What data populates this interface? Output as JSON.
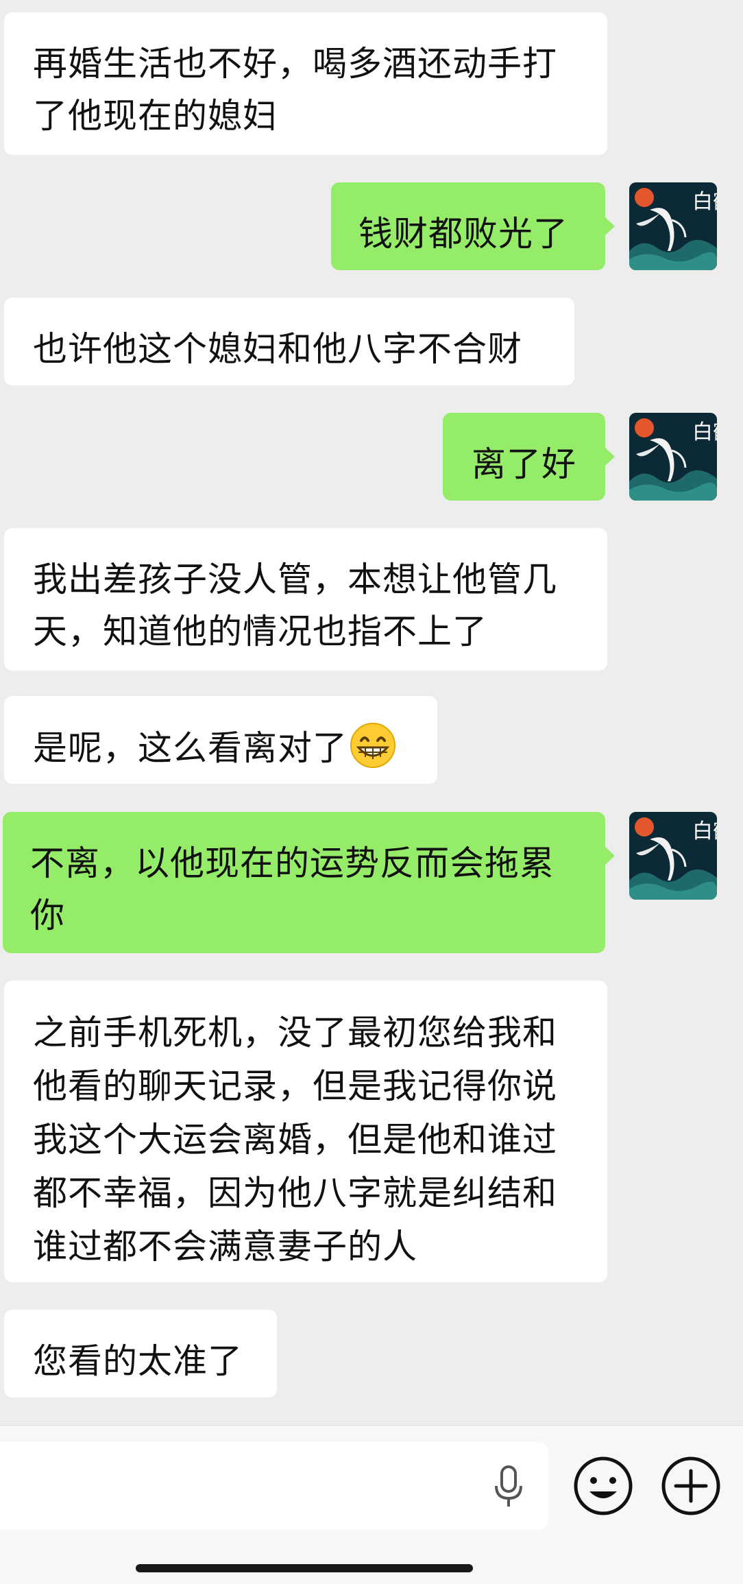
{
  "messages": [
    {
      "side": "in",
      "text": "再婚生活也不好，喝多酒还动手打了他现在的媳妇"
    },
    {
      "side": "out",
      "text": "钱财都败光了"
    },
    {
      "side": "in",
      "text": "也许他这个媳妇和他八字不合财"
    },
    {
      "side": "out",
      "text": "离了好"
    },
    {
      "side": "in",
      "text": "我出差孩子没人管，本想让他管几天，知道他的情况也指不上了"
    },
    {
      "side": "in",
      "text": "是呢，这么看离对了",
      "emoji": "grinning-face-emoji"
    },
    {
      "side": "out",
      "text": "不离，以他现在的运势反而会拖累你"
    },
    {
      "side": "in",
      "text": "之前手机死机，没了最初您给我和他看的聊天记录，但是我记得你说我这个大运会离婚，但是他和谁过都不幸福，因为他八字就是纠结和谁过都不会满意妻子的人"
    },
    {
      "side": "in",
      "text": "您看的太准了"
    }
  ],
  "avatar": {
    "text": "白鹤",
    "bg_color": "#0c2a35"
  },
  "colors": {
    "outgoing": "#95ec69",
    "incoming": "#ffffff",
    "background": "#ededed"
  },
  "input_bar": {
    "icons": [
      "microphone-icon",
      "emoji-icon",
      "plus-icon"
    ]
  }
}
